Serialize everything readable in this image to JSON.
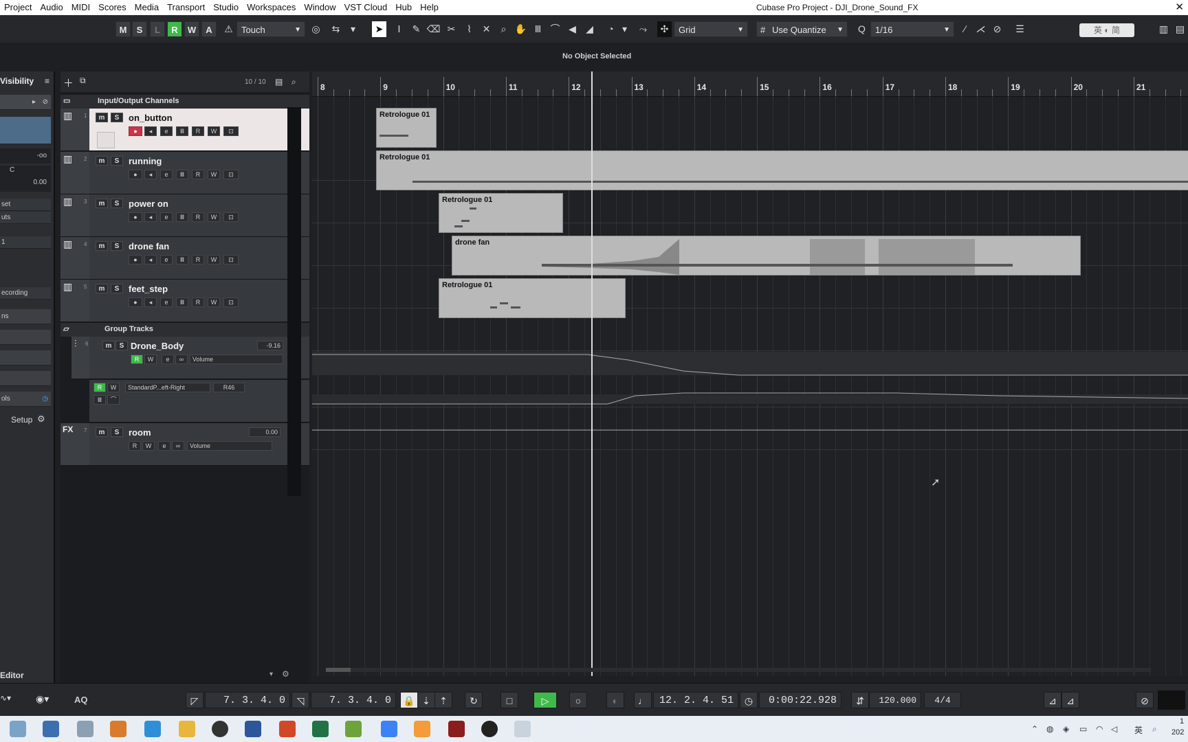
{
  "menubar": {
    "items": [
      "Project",
      "Audio",
      "MIDI",
      "Scores",
      "Media",
      "Transport",
      "Studio",
      "Workspaces",
      "Window",
      "VST Cloud",
      "Hub",
      "Help"
    ],
    "window_title": "Cubase Pro Project - DJI_Drone_Sound_FX",
    "close": "✕"
  },
  "toolbar": {
    "state_buttons": [
      "M",
      "S",
      "L",
      "R",
      "W",
      "A"
    ],
    "automation_mode": "Touch",
    "snap_type": "Grid",
    "quantize_mode": "Use Quantize",
    "quantize_value": "1/16",
    "ime_text": "英 ◐ 简"
  },
  "info_line": {
    "text": "No Object Selected"
  },
  "inspector": {
    "title": "Visibility",
    "volume_value": "-oo",
    "pan_label": "C",
    "pan_value": "0.00",
    "preset_label": "set",
    "outputs_label": "uts",
    "chan_number": "1",
    "recording_label": "ecording",
    "tabs": [
      "ns",
      "",
      "",
      ""
    ],
    "tools_label": "ols",
    "setup_label": "Setup",
    "editor_label": "Editor"
  },
  "tracklist": {
    "count": "10 / 10",
    "folder_io": "Input/Output Channels",
    "folder_group": "Group Tracks",
    "tracks": [
      {
        "num": "1",
        "name": "on_button"
      },
      {
        "num": "2",
        "name": "running"
      },
      {
        "num": "3",
        "name": "power on"
      },
      {
        "num": "4",
        "name": "drone fan"
      },
      {
        "num": "5",
        "name": "feet_step"
      }
    ],
    "group_track": {
      "num": "6",
      "name": "Drone_Body",
      "volume_value": "-9.16",
      "param": "Volume",
      "automation_lane": "StandardP...eft-Right",
      "automation_value": "R46"
    },
    "fx_track": {
      "num": "7",
      "name": "room",
      "volume_value": "0.00",
      "param": "Volume",
      "prefix": "FX"
    }
  },
  "ruler": {
    "bars": [
      "8",
      "9",
      "10",
      "11",
      "12",
      "13",
      "14",
      "15",
      "16",
      "17",
      "18",
      "19",
      "20",
      "21"
    ]
  },
  "events": [
    {
      "title": "Retrologue 01"
    },
    {
      "title": "Retrologue 01"
    },
    {
      "title": "Retrologue 01"
    },
    {
      "title": "drone fan"
    },
    {
      "title": "Retrologue 01"
    }
  ],
  "transport": {
    "left_locator": "7. 3. 4.   0",
    "right_locator": "7. 3. 4.   0",
    "primary_time": "12. 2. 4. 51",
    "secondary_time": "0:00:22.928",
    "tempo": "120.000",
    "signature": "4/4",
    "aq": "AQ"
  },
  "taskbar": {
    "clock_top": "1",
    "clock_bottom": "202"
  }
}
